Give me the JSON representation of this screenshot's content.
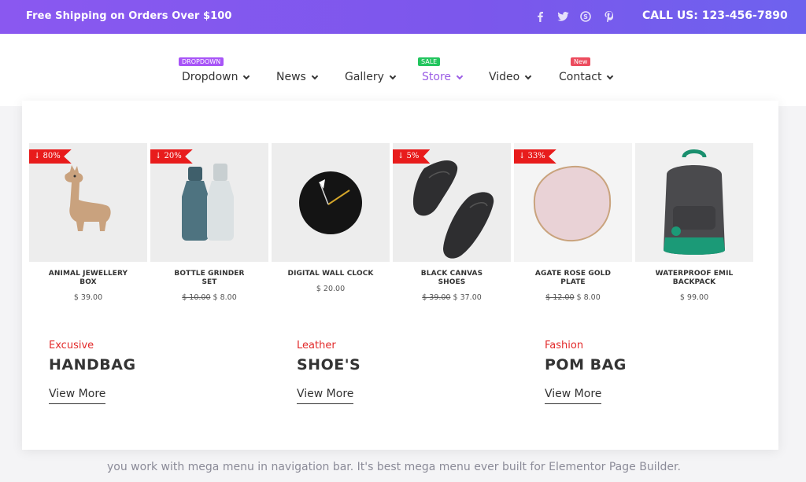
{
  "topbar": {
    "shipping": "Free Shipping on Orders Over $100",
    "call": "CALL US: 123-456-7890",
    "socials": [
      "facebook-icon",
      "twitter-icon",
      "skype-icon",
      "pinterest-icon"
    ]
  },
  "nav": {
    "items": [
      {
        "label": "Dropdown",
        "badge": "DROPDOWN",
        "badge_color": "#a855f7"
      },
      {
        "label": "News"
      },
      {
        "label": "Gallery"
      },
      {
        "label": "Store",
        "badge": "SALE",
        "badge_color": "#22c55e",
        "active": true
      },
      {
        "label": "Video"
      },
      {
        "label": "Contact",
        "badge": "New",
        "badge_color": "#ec4c5e"
      }
    ],
    "active_color": "#9b5de5"
  },
  "products": [
    {
      "name": "ANIMAL JEWELLERY BOX",
      "price": "$ 39.00",
      "discount": "↓ 80%"
    },
    {
      "name": "BOTTLE GRINDER SET",
      "old_price": "$ 10.00",
      "price": "$ 8.00",
      "discount": "↓ 20%"
    },
    {
      "name": "DIGITAL WALL CLOCK",
      "price": "$ 20.00"
    },
    {
      "name": "BLACK CANVAS SHOES",
      "old_price": "$ 39.00",
      "price": "$ 37.00",
      "discount": "↓ 5%"
    },
    {
      "name": "AGATE ROSE GOLD PLATE",
      "old_price": "$ 12.00",
      "price": "$ 8.00",
      "discount": "↓ 33%"
    },
    {
      "name": "WATERPROOF EMIL BACKPACK",
      "price": "$ 99.00"
    }
  ],
  "promos": [
    {
      "category": "Excusive",
      "title": "HANDBAG",
      "link": "View More"
    },
    {
      "category": "Leather",
      "title": "SHOE'S",
      "link": "View More"
    },
    {
      "category": "Fashion",
      "title": "POM BAG",
      "link": "View More"
    }
  ],
  "body_text": "you work with mega menu in navigation bar. It's best mega menu ever built for Elementor Page Builder.",
  "colors": {
    "accent": "#7b57ec",
    "discount": "#e81c1c",
    "category": "#e22b2b"
  }
}
